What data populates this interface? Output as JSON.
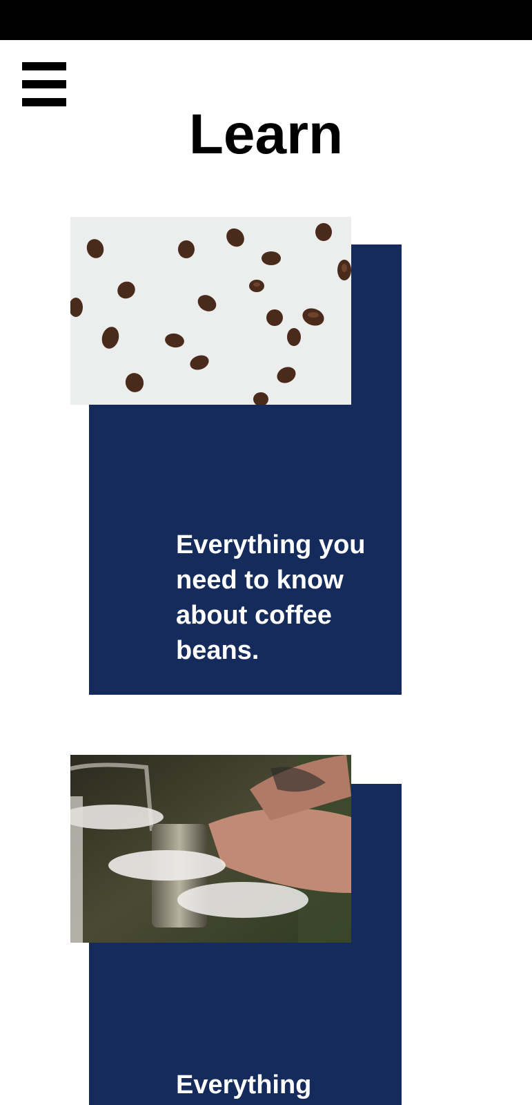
{
  "header": {
    "title": "Learn",
    "menu_icon": "hamburger-menu-icon"
  },
  "colors": {
    "status_bar": "#000000",
    "card_panel": "#142b5c",
    "card_text": "#ffffff",
    "title": "#000000"
  },
  "cards": [
    {
      "text": "Everything you need to know about coffee beans.",
      "image": "coffee-beans-photo"
    },
    {
      "text": "Everything",
      "image": "barista-hands-photo"
    }
  ]
}
